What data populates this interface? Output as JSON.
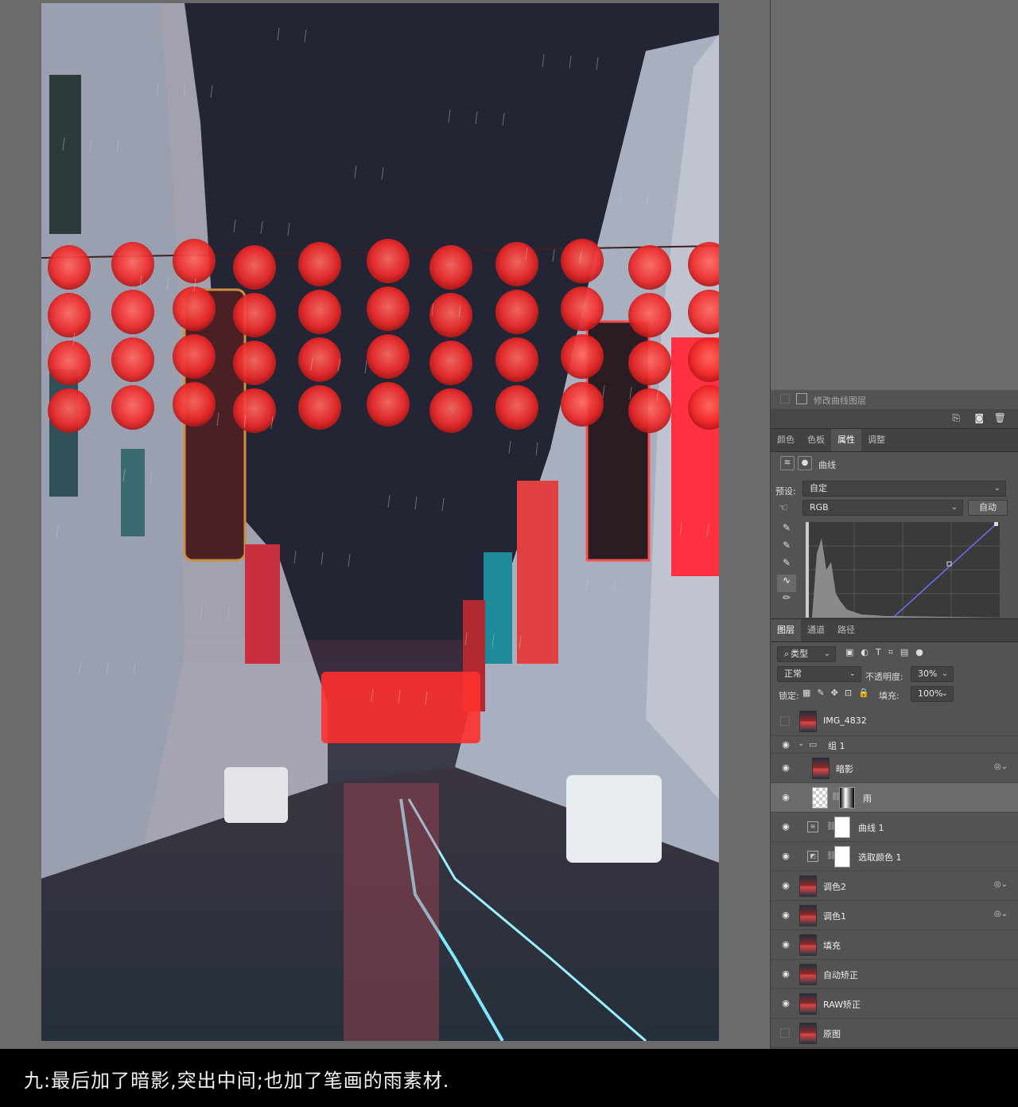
{
  "panel": {
    "top_layer_label": "修改曲线图层",
    "tabs": [
      "颜色",
      "色板",
      "属性",
      "调整"
    ],
    "properties": {
      "adjustment_name": "曲线",
      "preset_label": "预设:",
      "preset_value": "自定",
      "channel_value": "RGB",
      "auto_label": "自动"
    },
    "layers_tabs": [
      "图层",
      "通道",
      "路径"
    ],
    "filter_kind": "类型",
    "blend_mode": "正常",
    "opacity_label": "不透明度:",
    "opacity_value": "30%",
    "lock_label": "锁定:",
    "fill_label": "填充:",
    "fill_value": "100%",
    "layers": [
      {
        "name": "IMG_4832",
        "visible": false
      },
      {
        "name": "组 1",
        "visible": true,
        "type": "group"
      },
      {
        "name": "暗影",
        "visible": true
      },
      {
        "name": "雨",
        "visible": true,
        "selected": true
      },
      {
        "name": "曲线 1",
        "visible": true,
        "type": "adjustment"
      },
      {
        "name": "选取颜色 1",
        "visible": true,
        "type": "adjustment"
      },
      {
        "name": "调色2",
        "visible": true
      },
      {
        "name": "调色1",
        "visible": true
      },
      {
        "name": "填充",
        "visible": true
      },
      {
        "name": "自动矫正",
        "visible": true
      },
      {
        "name": "RAW矫正",
        "visible": true
      },
      {
        "name": "原图",
        "visible": false
      }
    ]
  },
  "caption": "九:最后加了暗影,突出中间;也加了笔画的雨素材."
}
